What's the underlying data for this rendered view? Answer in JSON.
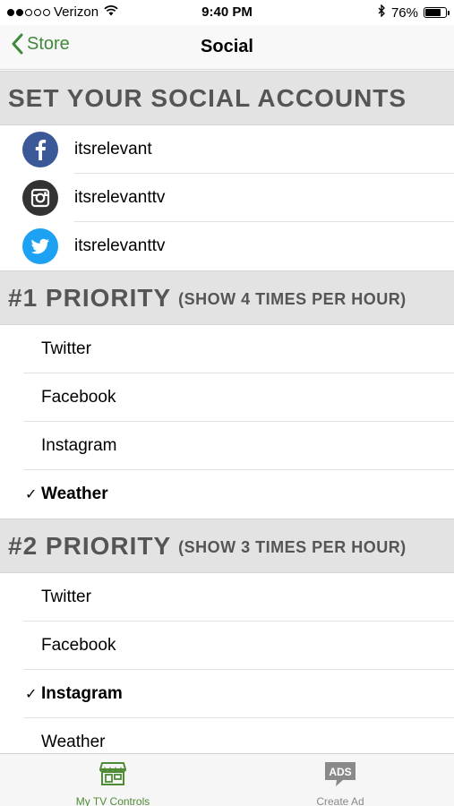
{
  "status_bar": {
    "carrier": "Verizon",
    "time": "9:40 PM",
    "battery": "76%",
    "battery_level": 0.76,
    "signal_dots": [
      true,
      true,
      false,
      false,
      false
    ]
  },
  "nav": {
    "back_label": "Store",
    "title": "Social"
  },
  "accounts_section": {
    "title": "SET YOUR SOCIAL ACCOUNTS",
    "accounts": [
      {
        "service": "facebook",
        "icon": "facebook-icon",
        "color": "#3b5998",
        "handle": "itsrelevant"
      },
      {
        "service": "instagram",
        "icon": "instagram-icon",
        "color": "#333333",
        "handle": "itsrelevanttv"
      },
      {
        "service": "twitter",
        "icon": "twitter-icon",
        "color": "#1da1f2",
        "handle": "itsrelevanttv"
      }
    ]
  },
  "priority1": {
    "title": "#1 PRIORITY",
    "subtitle": "(SHOW 4 TIMES PER HOUR)",
    "options": [
      {
        "label": "Twitter",
        "checked": false
      },
      {
        "label": "Facebook",
        "checked": false
      },
      {
        "label": "Instagram",
        "checked": false
      },
      {
        "label": "Weather",
        "checked": true
      }
    ]
  },
  "priority2": {
    "title": "#2 PRIORITY",
    "subtitle": "(SHOW 3 TIMES PER HOUR)",
    "options": [
      {
        "label": "Twitter",
        "checked": false
      },
      {
        "label": "Facebook",
        "checked": false
      },
      {
        "label": "Instagram",
        "checked": true
      },
      {
        "label": "Weather",
        "checked": false
      }
    ]
  },
  "check_mark": "✓",
  "tabbar": {
    "tabs": [
      {
        "label": "My TV Controls",
        "icon": "storefront-icon",
        "active": true
      },
      {
        "label": "Create Ad",
        "icon": "ads-icon",
        "active": false,
        "icon_text": "ADS"
      }
    ],
    "active_color": "#4f8b35",
    "inactive_color": "#8a8a8a"
  },
  "colors": {
    "accent": "#3e8a3a",
    "section_bg": "#e3e3e3",
    "section_text": "#555555"
  }
}
